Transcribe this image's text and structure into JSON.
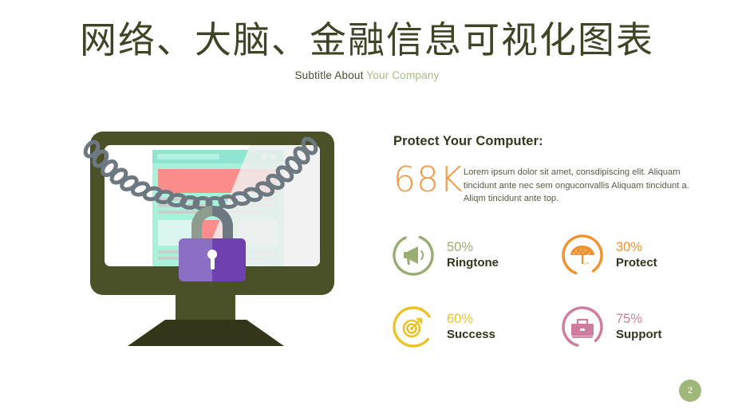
{
  "slide": {
    "background_color": "#ffffff",
    "title": "网络、大脑、金融信息可视化图表",
    "subtitle_main": "Subtitle About ",
    "subtitle_accent": "Your Company",
    "page_number": "2"
  },
  "illustration": {
    "name": "chained-computer-illustration",
    "monitor_color": "#4b5127",
    "base_color": "#333618",
    "chain_color": "#6e7880",
    "lock_color_light": "#8b6fc4",
    "lock_color_dark": "#6d42b0",
    "screen_page_color": "#a8f2dc",
    "screen_banner_color": "#fb8d8d"
  },
  "panel": {
    "heading": "Protect Your Computer:",
    "kpi_number": "68K",
    "kpi_color": "#f19a47",
    "body_lines": "Lorem ipsum dolor sit amet, consdipiscing elit. Aliquam tincidunt ante nec sem onguconvallis Aliquam tincidunt a. Aliqm tincidunt ante top."
  },
  "chart_data": {
    "type": "pie",
    "title": "Protect Your Computer:",
    "legend_position": "inline-right-of-ring",
    "categories": [
      "Ringtone",
      "Protect",
      "Success",
      "Support"
    ],
    "values": [
      50,
      30,
      60,
      75
    ],
    "unit": "%",
    "colors": [
      "#9aab74",
      "#f0922f",
      "#ecc327",
      "#ce7d9e"
    ],
    "icons": [
      "megaphone-icon",
      "umbrella-icon",
      "target-icon",
      "briefcase-icon"
    ]
  },
  "stats": [
    {
      "percent": "50%",
      "label": "Ringtone",
      "value": 50,
      "color": "#9aab74",
      "icon": "megaphone-icon"
    },
    {
      "percent": "30%",
      "label": "Protect",
      "value": 30,
      "color": "#f0922f",
      "icon": "umbrella-icon"
    },
    {
      "percent": "60%",
      "label": "Success",
      "value": 60,
      "color": "#ecc327",
      "icon": "target-icon"
    },
    {
      "percent": "75%",
      "label": "Support",
      "value": 75,
      "color": "#ce7d9e",
      "icon": "briefcase-icon"
    }
  ]
}
